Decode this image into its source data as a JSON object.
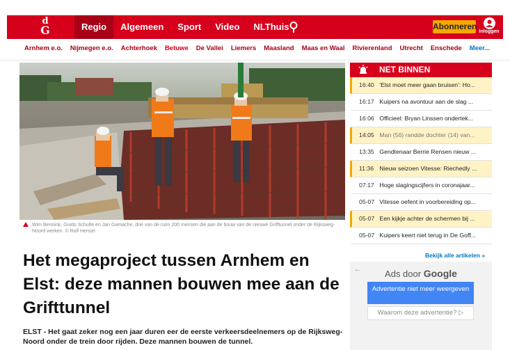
{
  "header": {
    "logo_top": "d",
    "logo_bottom": "G",
    "nav": [
      {
        "label": "Regio",
        "active": true
      },
      {
        "label": "Algemeen",
        "active": false
      },
      {
        "label": "Sport",
        "active": false
      },
      {
        "label": "Video",
        "active": false
      },
      {
        "label": "NLThuis",
        "active": false
      }
    ],
    "search_icon": "search-icon",
    "subscribe_label": "Abonneren",
    "login_label": "Inloggen",
    "brand_color": "#d6001c"
  },
  "subnav": [
    "Arnhem e.o.",
    "Nijmegen e.o.",
    "Achterhoek",
    "Betuwe",
    "De Vallei",
    "Liemers",
    "Maasland",
    "Maas en Waal",
    "Rivierenland",
    "Utrecht",
    "Enschede",
    "Meer..."
  ],
  "article": {
    "caption": "Wim Bennink, Guido Schulte en Jan Gamache, drie van de ruim 200 mensen die aan de bouw van de nieuwe Grifftunnel onder de Rijksweg-Noord werken. © Rolf Hensel",
    "headline": "Het megaproject tussen Arnhem en Elst: deze mannen bouwen mee aan de Grifttunnel",
    "lead": "ELST - Het gaat zeker nog een jaar duren eer de eerste verkeersdeelnemers op de Rijksweg-Noord onder de trein door rijden. Deze mannen bouwen de tunnel."
  },
  "net_binnen": {
    "title": "NET BINNEN",
    "items": [
      {
        "time": "16:40",
        "text": "'Elst moet meer gaan bruisen': Ho...",
        "highlight": true
      },
      {
        "time": "16:17",
        "text": "Kuipers na avontuur aan de slag ...",
        "highlight": false
      },
      {
        "time": "16:06",
        "text": "Officieel: Bryan Linssen ondertek...",
        "highlight": false
      },
      {
        "time": "14:05",
        "text": "Man (56) randde dochter (14) van...",
        "highlight": true,
        "dim": true
      },
      {
        "time": "13:35",
        "text": "Gendtenaar Berrie Rensen nieuw ...",
        "highlight": false
      },
      {
        "time": "11:36",
        "text": "Nieuw seizoen Vitesse: Riechedly ...",
        "highlight": true
      },
      {
        "time": "07:17",
        "text": "Hoge slagingscijfers in coronajaar...",
        "highlight": false
      },
      {
        "time": "05-07",
        "text": "Vitesse oefent in voorbereiding op...",
        "highlight": false
      },
      {
        "time": "05-07",
        "text": "Een kijkje achter de schermen bij ...",
        "highlight": true
      },
      {
        "time": "05-07",
        "text": "Kuipers keert niet terug in De Goff...",
        "highlight": false
      }
    ],
    "all_link": "Bekijk alle artikelen"
  },
  "ad": {
    "by_prefix": "Ads door",
    "by_brand": "Google",
    "hide_label": "Advertentie niet meer weergeven",
    "why_label": "Waarom deze advertentie?"
  }
}
